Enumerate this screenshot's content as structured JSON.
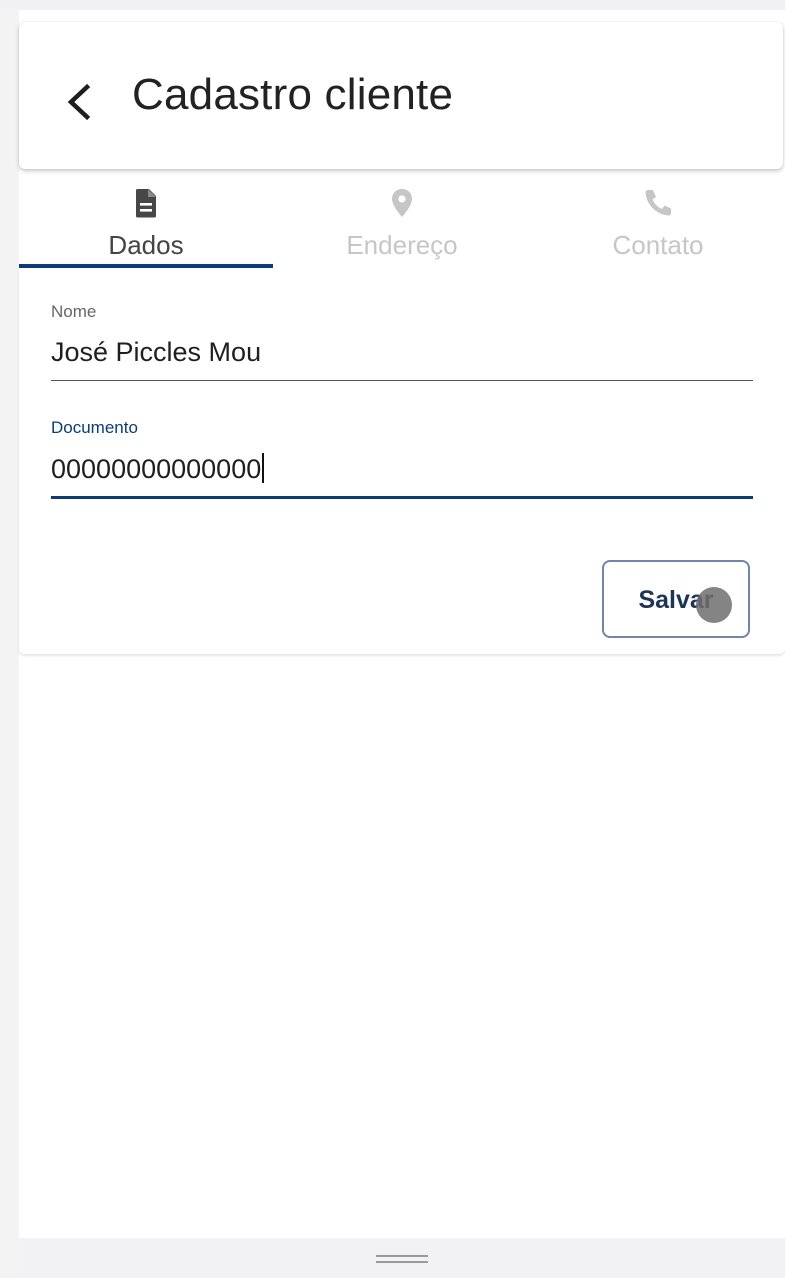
{
  "header": {
    "title": "Cadastro cliente",
    "back_icon": "chevron-left-icon"
  },
  "tabs": [
    {
      "label": "Dados",
      "icon": "document-icon",
      "active": true
    },
    {
      "label": "Endereço",
      "icon": "map-pin-icon",
      "active": false
    },
    {
      "label": "Contato",
      "icon": "phone-icon",
      "active": false
    }
  ],
  "form": {
    "nome": {
      "label": "Nome",
      "value": "José Piccles Mou"
    },
    "documento": {
      "label": "Documento",
      "value": "00000000000000",
      "focused": true
    }
  },
  "actions": {
    "save_label": "Salvar"
  },
  "colors": {
    "primary": "#0b3d74",
    "active_tab_text": "#444444",
    "inactive_tab": "#c6c6c6",
    "focused_label": "#0b3d74",
    "button_border": "#6f86a8"
  }
}
